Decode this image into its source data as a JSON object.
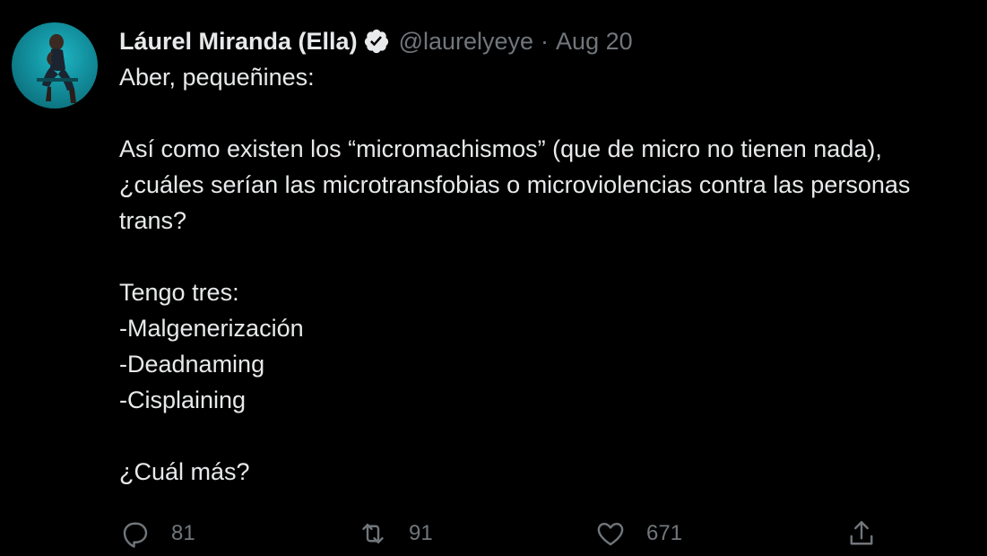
{
  "tweet": {
    "author": {
      "display_name": "Láurel Miranda (Ella)",
      "handle": "@laurelyeye",
      "verified": true,
      "avatar_icon": "profile-photo"
    },
    "separator": "·",
    "date": "Aug 20",
    "lines": [
      "Aber, pequeñines:",
      "",
      "Así como existen los “micromachismos” (que de micro no tienen nada),",
      "¿cuáles serían las microtransfobias o microviolencias contra las personas",
      "trans?",
      "",
      "Tengo tres:",
      "-Malgenerización",
      "-Deadnaming",
      "-Cisplaining",
      "",
      "¿Cuál más?"
    ],
    "actions": {
      "reply": {
        "icon": "reply-icon",
        "count": "81"
      },
      "retweet": {
        "icon": "retweet-icon",
        "count": "91"
      },
      "like": {
        "icon": "heart-icon",
        "count": "671"
      },
      "share": {
        "icon": "share-icon"
      }
    }
  },
  "colors": {
    "background": "#000000",
    "primary_text": "#e7e9ea",
    "secondary_text": "#71767b",
    "verified_badge": "#e7e9ea",
    "avatar_background": "#128e9c"
  }
}
